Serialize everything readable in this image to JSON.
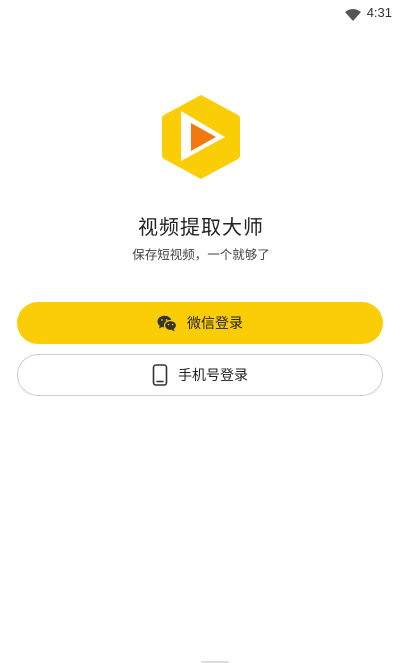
{
  "status_bar": {
    "time": "4:31",
    "wifi_icon": "wifi-icon"
  },
  "app": {
    "title": "视频提取大师",
    "subtitle": "保存短视频，一个就够了",
    "logo_icon": "play-hexagon-logo",
    "colors": {
      "brand_yellow": "#fbcd06",
      "play_orange": "#f07a0e"
    }
  },
  "login": {
    "wechat_label": "微信登录",
    "wechat_icon": "wechat-icon",
    "phone_label": "手机号登录",
    "phone_icon": "phone-icon"
  }
}
